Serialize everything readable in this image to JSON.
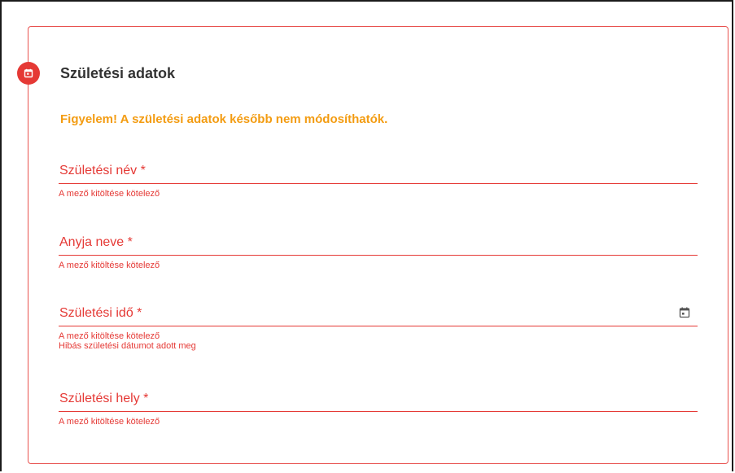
{
  "section": {
    "title": "Születési adatok",
    "warning": "Figyelem! A születési adatok később nem módosíthatók."
  },
  "fields": [
    {
      "label": "Születési név *",
      "errors": [
        "A mező kitöltése kötelező"
      ]
    },
    {
      "label": "Anyja neve *",
      "errors": [
        "A mező kitöltése kötelező"
      ]
    },
    {
      "label": "Születési idő *",
      "errors": [
        "A mező kitöltése kötelező",
        "Hibás születési dátumot adott meg"
      ]
    },
    {
      "label": "Születési hely *",
      "errors": [
        "A mező kitöltése kötelező"
      ]
    }
  ],
  "icons": {
    "step": "calendar-icon",
    "date_picker": "calendar-icon"
  },
  "colors": {
    "error": "#e53935",
    "warning": "#f39c12",
    "title": "#333333",
    "card_border": "#e8514f"
  }
}
